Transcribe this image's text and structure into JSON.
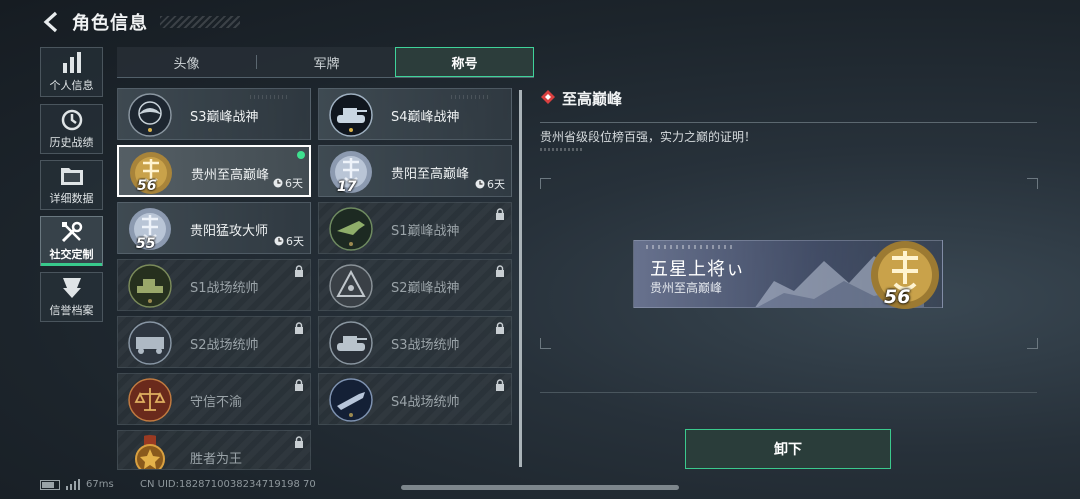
{
  "header": {
    "title": "角色信息",
    "back_icon": "back-arrow-icon"
  },
  "sidebar": {
    "items": [
      {
        "label": "个人信息",
        "icon": "bar-chart-icon",
        "active": false
      },
      {
        "label": "历史战绩",
        "icon": "history-clock-icon",
        "active": false
      },
      {
        "label": "详细数据",
        "icon": "folder-icon",
        "active": false
      },
      {
        "label": "社交定制",
        "icon": "tools-icon",
        "active": true
      },
      {
        "label": "信誉档案",
        "icon": "shield-badge-icon",
        "active": false
      }
    ]
  },
  "tabs": [
    {
      "label": "头像",
      "active": false
    },
    {
      "label": "军牌",
      "active": false
    },
    {
      "label": "称号",
      "active": true
    }
  ],
  "titles": [
    {
      "name": "S3巅峰战神",
      "locked": false
    },
    {
      "name": "S4巅峰战神",
      "locked": false
    },
    {
      "name": "贵州至高巅峰",
      "locked": false,
      "selected": true,
      "equipped": true,
      "rank": "56",
      "timer": "6天"
    },
    {
      "name": "贵阳至高巅峰",
      "locked": false,
      "rank": "17",
      "timer": "6天"
    },
    {
      "name": "贵阳猛攻大师",
      "locked": false,
      "rank": "55",
      "timer": "6天"
    },
    {
      "name": "S1巅峰战神",
      "locked": true
    },
    {
      "name": "S1战场统帅",
      "locked": true
    },
    {
      "name": "S2巅峰战神",
      "locked": true
    },
    {
      "name": "S2战场统帅",
      "locked": true
    },
    {
      "name": "S3战场统帅",
      "locked": true
    },
    {
      "name": "守信不渝",
      "locked": true
    },
    {
      "name": "S4战场统帅",
      "locked": true
    },
    {
      "name": "胜者为王",
      "locked": true
    }
  ],
  "detail": {
    "title": "至高巅峰",
    "description": "贵州省级段位榜百强，实力之巅的证明！",
    "banner": {
      "title": "五星上将ぃ",
      "subtitle": "贵州至高巅峰",
      "rank": "56"
    },
    "unequip_label": "卸下"
  },
  "status_bar": {
    "ping": "67ms",
    "uid": "CN UID:1828710038234719198 70"
  },
  "colors": {
    "accent": "#3ee08f",
    "gold": "#c9a24a",
    "background": "#1f2830"
  }
}
